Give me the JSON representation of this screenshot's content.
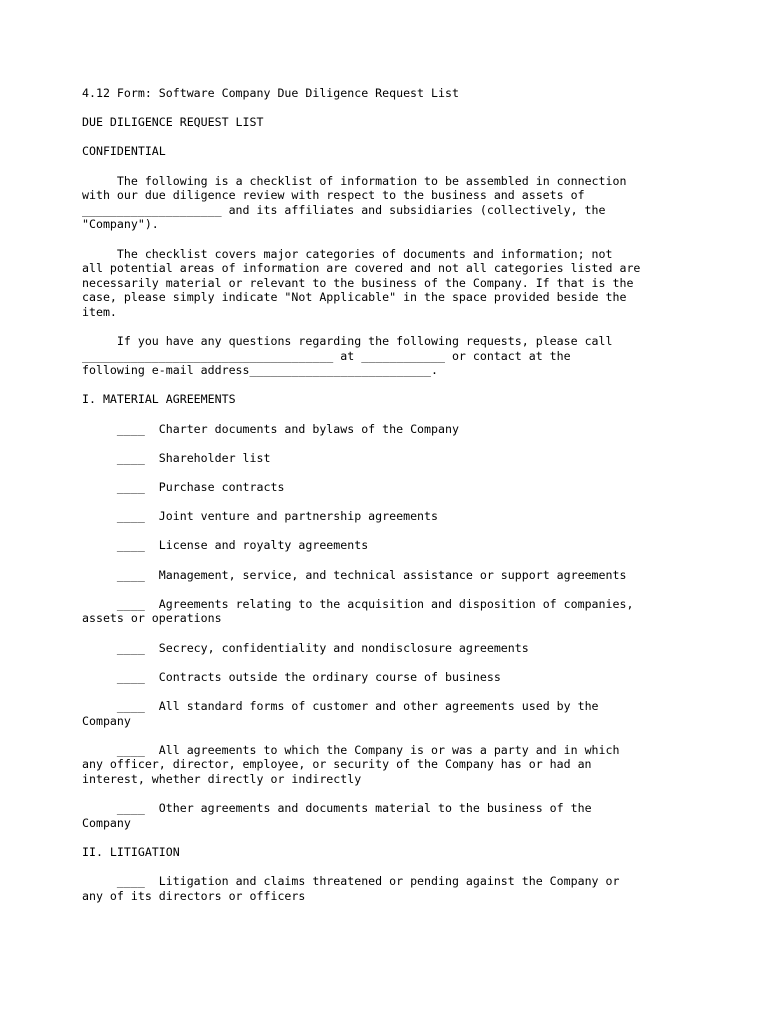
{
  "document": {
    "form_number_and_title": "4.12 Form: Software Company Due Diligence Request List",
    "heading": "DUE DILIGENCE REQUEST LIST",
    "confidentiality_notice": "CONFIDENTIAL",
    "intro_paragraph": "     The following is a checklist of information to be assembled in connection\nwith our due diligence review with respect to the business and assets of\n____________________ and its affiliates and subsidiaries (collectively, the\n\"Company\").",
    "scope_paragraph": "     The checklist covers major categories of documents and information; not\nall potential areas of information are covered and not all categories listed are\nnecessarily material or relevant to the business of the Company. If that is the\ncase, please simply indicate \"Not Applicable\" in the space provided beside the\nitem.",
    "contact_paragraph": "     If you have any questions regarding the following requests, please call\n____________________________________ at ____________ or contact at the\nfollowing e-mail address__________________________.",
    "sections": [
      {
        "number_and_title": "I. MATERIAL AGREEMENTS",
        "items": [
          "     ____  Charter documents and bylaws of the Company",
          "     ____  Shareholder list",
          "     ____  Purchase contracts",
          "     ____  Joint venture and partnership agreements",
          "     ____  License and royalty agreements",
          "     ____  Management, service, and technical assistance or support agreements",
          "     ____  Agreements relating to the acquisition and disposition of companies,\nassets or operations",
          "     ____  Secrecy, confidentiality and nondisclosure agreements",
          "     ____  Contracts outside the ordinary course of business",
          "     ____  All standard forms of customer and other agreements used by the\nCompany",
          "     ____  All agreements to which the Company is or was a party and in which\nany officer, director, employee, or security of the Company has or had an\ninterest, whether directly or indirectly",
          "     ____  Other agreements and documents material to the business of the\nCompany"
        ]
      },
      {
        "number_and_title": "II. LITIGATION",
        "items": [
          "     ____  Litigation and claims threatened or pending against the Company or\nany of its directors or officers"
        ]
      }
    ]
  },
  "style": {
    "text_color": "#000000",
    "page_background": "#ffffff"
  }
}
